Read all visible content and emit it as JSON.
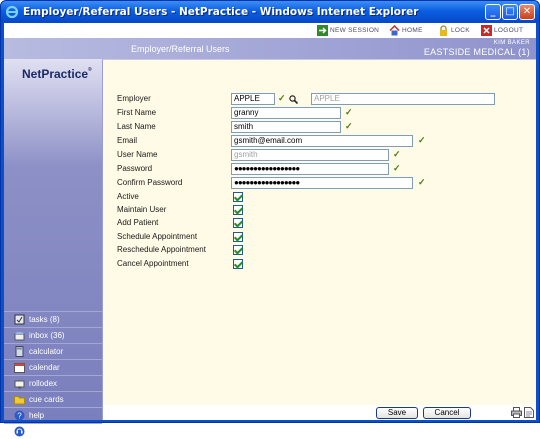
{
  "window": {
    "title": "Employer/Referral Users - NetPractice - Windows Internet Explorer"
  },
  "toolbar": {
    "new_session": "NEW SESSION",
    "home": "HOME",
    "lock": "LOCK",
    "logout": "LOGOUT"
  },
  "header": {
    "title": "Employer/Referral Users",
    "user": "KIM BAKER",
    "org": "EASTSIDE MEDICAL (1)"
  },
  "logo": {
    "text": "NetPractice",
    "mark": "®"
  },
  "sidebar": {
    "items": [
      {
        "label": "tasks (8)",
        "icon": "tasks-icon"
      },
      {
        "label": "inbox (36)",
        "icon": "inbox-icon"
      },
      {
        "label": "calculator",
        "icon": "calculator-icon"
      },
      {
        "label": "calendar",
        "icon": "calendar-icon"
      },
      {
        "label": "rollodex",
        "icon": "rolodex-icon"
      },
      {
        "label": "cue cards",
        "icon": "folder-icon"
      },
      {
        "label": "help",
        "icon": "help-icon"
      },
      {
        "label": "support",
        "icon": "support-icon"
      }
    ]
  },
  "form": {
    "employer_label": "Employer",
    "employer_code": "APPLE",
    "employer_name": "APPLE",
    "first_name_label": "First Name",
    "first_name": "granny",
    "last_name_label": "Last Name",
    "last_name": "smith",
    "email_label": "Email",
    "email": "gsmith@email.com",
    "username_label": "User Name",
    "username": "gsmith",
    "password_label": "Password",
    "password": "●●●●●●●●●●●●●●●●●",
    "confirm_label": "Confirm Password",
    "confirm": "●●●●●●●●●●●●●●●●●",
    "checkboxes": [
      {
        "label": "Active",
        "checked": true
      },
      {
        "label": "Maintain User",
        "checked": true
      },
      {
        "label": "Add Patient",
        "checked": true
      },
      {
        "label": "Schedule Appointment",
        "checked": true
      },
      {
        "label": "Reschedule Appointment",
        "checked": true
      },
      {
        "label": "Cancel Appointment",
        "checked": true
      }
    ]
  },
  "footer": {
    "save": "Save",
    "cancel": "Cancel"
  }
}
